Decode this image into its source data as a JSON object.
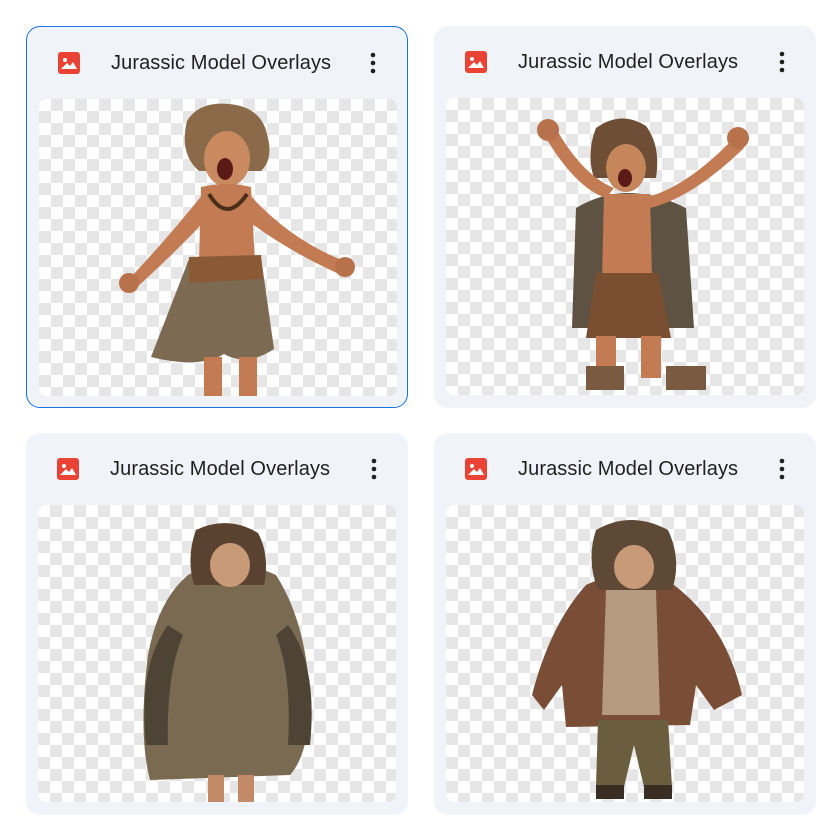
{
  "files": [
    {
      "name": "Jurassic Model Overlays",
      "type_icon": "image-file-icon",
      "selected": true
    },
    {
      "name": "Jurassic Model Overlays",
      "type_icon": "image-file-icon",
      "selected": false
    },
    {
      "name": "Jurassic Model Overlays",
      "type_icon": "image-file-icon",
      "selected": false
    },
    {
      "name": "Jurassic Model Overlays",
      "type_icon": "image-file-icon",
      "selected": false
    }
  ],
  "icons": {
    "file_type": "image-file-icon",
    "more": "more-vert-icon"
  },
  "colors": {
    "selected_border": "#1a73e8",
    "card_bg": "#f0f4f9",
    "image_icon": "#ea4335"
  }
}
